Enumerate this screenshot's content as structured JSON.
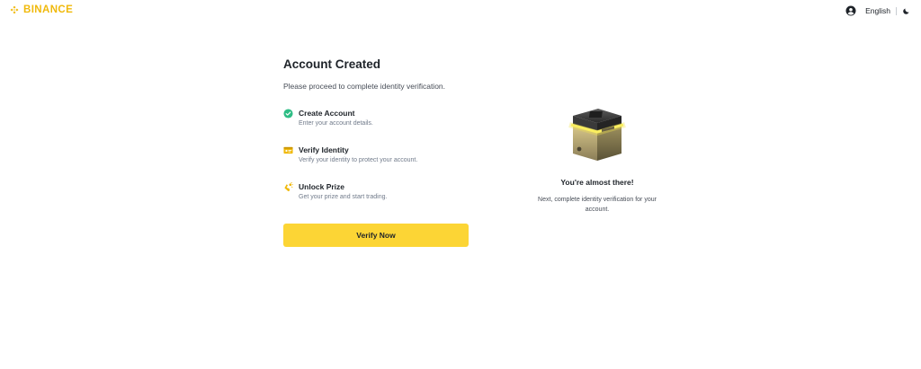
{
  "header": {
    "brand": "BINANCE",
    "language": "English",
    "icons": {
      "user": "user-circle-icon",
      "theme": "moon-icon",
      "logo": "binance-logo-icon"
    },
    "brand_color": "#F0B90B"
  },
  "main": {
    "title": "Account Created",
    "subtitle": "Please proceed to complete identity verification.",
    "steps": [
      {
        "title": "Create Account",
        "description": "Enter your account details.",
        "icon": "check-circle-icon",
        "status": "completed"
      },
      {
        "title": "Verify Identity",
        "description": "Verify your identity to protect your account.",
        "icon": "id-card-icon",
        "status": "pending"
      },
      {
        "title": "Unlock Prize",
        "description": "Get your prize and start trading.",
        "icon": "prize-icon",
        "status": "locked"
      }
    ],
    "button_label": "Verify Now",
    "accent_color": "#FCD535",
    "success_color": "#2EBD85"
  },
  "side": {
    "illustration": "glowing-box-illustration",
    "heading": "You're almost there!",
    "message": "Next, complete identity verification for your account."
  }
}
